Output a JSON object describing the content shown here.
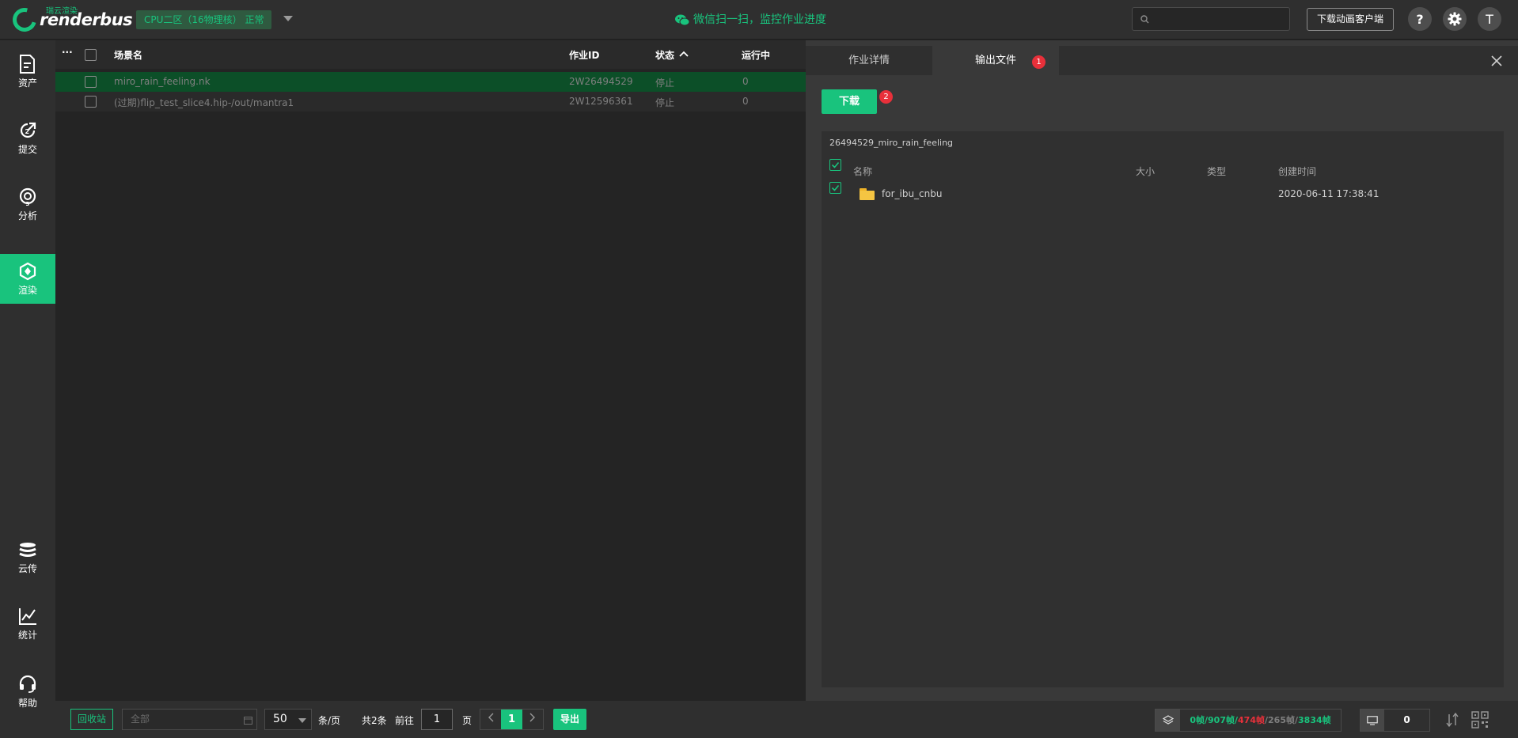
{
  "header": {
    "logo_cn": "瑞云渲染",
    "logo_en": "renderbus",
    "zone_label": "CPU二区（16物理核） 正常",
    "wechat_text": "微信扫一扫，监控作业进度",
    "search_placeholder": "",
    "download_client_label": "下载动画客户端",
    "help_label": "?",
    "avatar_letter": "T"
  },
  "sidebar": {
    "items": [
      {
        "label": "资产",
        "icon": "file-icon"
      },
      {
        "label": "提交",
        "icon": "submit-icon"
      },
      {
        "label": "分析",
        "icon": "analyze-icon"
      },
      {
        "label": "渲染",
        "icon": "render-icon",
        "active": true
      },
      {
        "label": "云传",
        "icon": "cloud-transfer-icon"
      },
      {
        "label": "统计",
        "icon": "stats-icon"
      },
      {
        "label": "帮助",
        "icon": "headset-icon"
      }
    ]
  },
  "job_list": {
    "columns": {
      "more": "···",
      "scene": "场景名",
      "job_id": "作业ID",
      "status": "状态",
      "running": "运行中"
    },
    "rows": [
      {
        "scene": "miro_rain_feeling.nk",
        "job_id": "2W26494529",
        "status": "停止",
        "running": "0"
      },
      {
        "scene": "(过期)flip_test_slice4.hip-/out/mantra1",
        "job_id": "2W12596361",
        "status": "停止",
        "running": "0"
      }
    ]
  },
  "detail": {
    "tabs": [
      "作业详情",
      "输出文件"
    ],
    "tab_badge": "1",
    "download_label": "下载",
    "download_badge": "2",
    "output_path": "26494529_miro_rain_feeling",
    "columns": {
      "name": "名称",
      "size": "大小",
      "type": "类型",
      "created": "创建时间"
    },
    "files": [
      {
        "name": "for_ibu_cnbu",
        "size": "",
        "type": "",
        "created": "2020-06-11 17:38:41"
      }
    ]
  },
  "footer": {
    "recycle_label": "回收站",
    "filter_all": "全部",
    "page_size": "50",
    "per_page": "条/页",
    "total": "共2条",
    "goto": "前往",
    "goto_value": "1",
    "page_unit": "页",
    "current_page": "1",
    "export_label": "导出",
    "frames": {
      "done": "0帧",
      "sep1": "/",
      "total_a": "907帧",
      "sep2": "/",
      "failed": "474帧",
      "sep3": "/",
      "stopped": "265帧",
      "sep4": "/",
      "all": "3834帧"
    },
    "machines": "0"
  },
  "colors": {
    "accent": "#19c37d",
    "failed": "#e8303a",
    "selected_row": "#0c4f28"
  }
}
